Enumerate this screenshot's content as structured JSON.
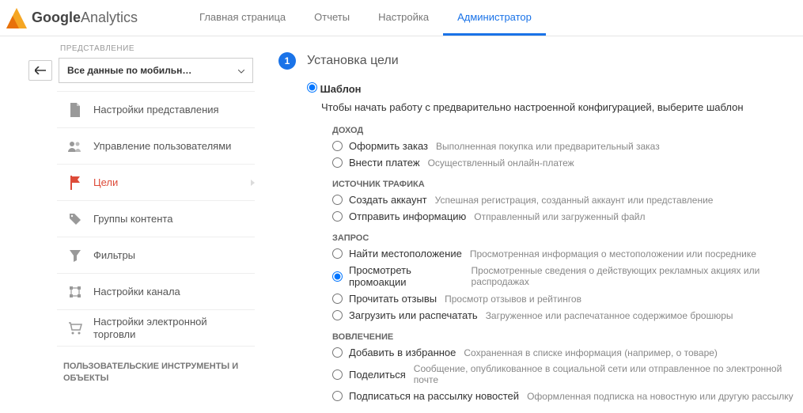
{
  "header": {
    "logo1": "Google",
    "logo2": " Analytics",
    "nav": [
      {
        "label": "Главная страница",
        "active": false
      },
      {
        "label": "Отчеты",
        "active": false
      },
      {
        "label": "Настройка",
        "active": false
      },
      {
        "label": "Администратор",
        "active": true
      }
    ]
  },
  "sidebar": {
    "section_label": "ПРЕДСТАВЛЕНИЕ",
    "view_selected": "Все данные по мобильн…",
    "items": [
      {
        "label": "Настройки представления",
        "icon": "doc"
      },
      {
        "label": "Управление пользователями",
        "icon": "users"
      },
      {
        "label": "Цели",
        "icon": "flag",
        "active": true
      },
      {
        "label": "Группы контента",
        "icon": "tag"
      },
      {
        "label": "Фильтры",
        "icon": "funnel"
      },
      {
        "label": "Настройки канала",
        "icon": "channel"
      },
      {
        "label": "Настройки электронной торговли",
        "icon": "cart"
      }
    ],
    "bottom_section": "ПОЛЬЗОВАТЕЛЬСКИЕ ИНСТРУМЕНТЫ И ОБЪЕКТЫ"
  },
  "main": {
    "step_num": "1",
    "step_title": "Установка цели",
    "type_label": "Шаблон",
    "type_help": "Чтобы начать работу с предварительно настроенной конфигурацией, выберите шаблон",
    "categories": [
      {
        "title": "ДОХОД",
        "options": [
          {
            "name": "Оформить заказ",
            "desc": "Выполненная покупка или предварительный заказ"
          },
          {
            "name": "Внести платеж",
            "desc": "Осуществленный онлайн-платеж"
          }
        ]
      },
      {
        "title": "ИСТОЧНИК ТРАФИКА",
        "options": [
          {
            "name": "Создать аккаунт",
            "desc": "Успешная регистрация, созданный аккаунт или представление"
          },
          {
            "name": "Отправить информацию",
            "desc": "Отправленный или загруженный файл"
          }
        ]
      },
      {
        "title": "ЗАПРОС",
        "options": [
          {
            "name": "Найти местоположение",
            "desc": "Просмотренная информация о местоположении или посреднике"
          },
          {
            "name": "Просмотреть промоакции",
            "desc": "Просмотренные сведения о действующих рекламных акциях или распродажах",
            "checked": true
          },
          {
            "name": "Прочитать отзывы",
            "desc": "Просмотр отзывов и рейтингов"
          },
          {
            "name": "Загрузить или распечатать",
            "desc": "Загруженное или распечатанное содержимое брошюры"
          }
        ]
      },
      {
        "title": "ВОВЛЕЧЕНИЕ",
        "options": [
          {
            "name": "Добавить в избранное",
            "desc": "Сохраненная в списке информация (например, о товаре)"
          },
          {
            "name": "Поделиться",
            "desc": "Сообщение, опубликованное в социальной сети или отправленное по электронной почте"
          },
          {
            "name": "Подписаться на рассылку новостей",
            "desc": "Оформленная подписка на новостную или другую рассылку"
          }
        ]
      }
    ]
  }
}
